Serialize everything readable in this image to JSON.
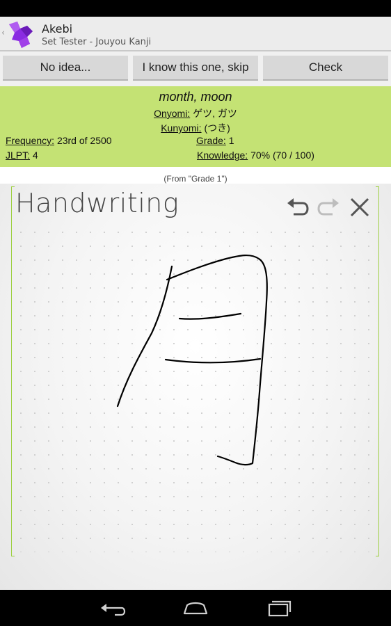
{
  "app": {
    "title": "Akebi",
    "subtitle": "Set Tester - Jouyou Kanji"
  },
  "buttons": {
    "no_idea": "No idea...",
    "know": "I know this one, skip",
    "check": "Check"
  },
  "info": {
    "meaning": "month, moon",
    "onyomi_label": "Onyomi:",
    "onyomi_value": "ゲツ, ガツ",
    "kunyomi_label": "Kunyomi:",
    "kunyomi_value": "(つき)",
    "frequency_label": "Frequency:",
    "frequency_value": "23rd of 2500",
    "grade_label": "Grade:",
    "grade_value": "1",
    "jlpt_label": "JLPT:",
    "jlpt_value": "4",
    "knowledge_label": "Knowledge:",
    "knowledge_value": "70% (70 / 100)"
  },
  "from_note": "(From \"Grade 1\")",
  "handwriting": {
    "title": "Handwriting"
  },
  "icons": {
    "app": "akebi-logo-icon",
    "undo": "undo-icon",
    "redo": "redo-icon",
    "clear": "close-icon",
    "back": "back-icon",
    "home": "home-icon",
    "recents": "recents-icon"
  },
  "colors": {
    "info_panel": "#c4e274",
    "bracket": "#9ccf3e",
    "app_icon": "#8a2be2"
  }
}
